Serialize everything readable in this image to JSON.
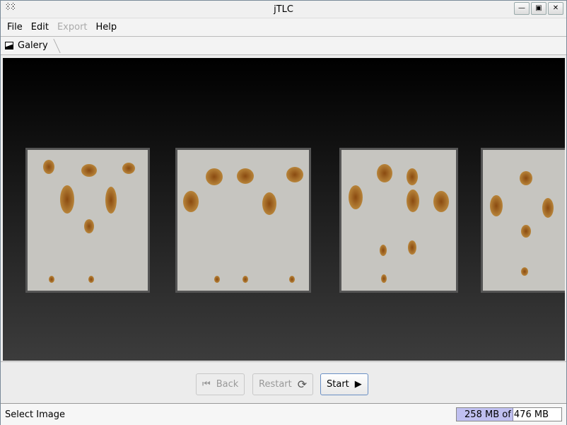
{
  "window": {
    "title": "jTLC"
  },
  "menu": {
    "items": [
      {
        "label": "File",
        "enabled": true
      },
      {
        "label": "Edit",
        "enabled": true
      },
      {
        "label": "Export",
        "enabled": false
      },
      {
        "label": "Help",
        "enabled": true
      }
    ]
  },
  "breadcrumb": {
    "label": "Galery"
  },
  "controls": {
    "back": "Back",
    "restart": "Restart",
    "start": "Start"
  },
  "status": {
    "text": "Select Image",
    "memory_text": "258 MB of 476 MB",
    "memory_used_fraction": 0.542
  }
}
